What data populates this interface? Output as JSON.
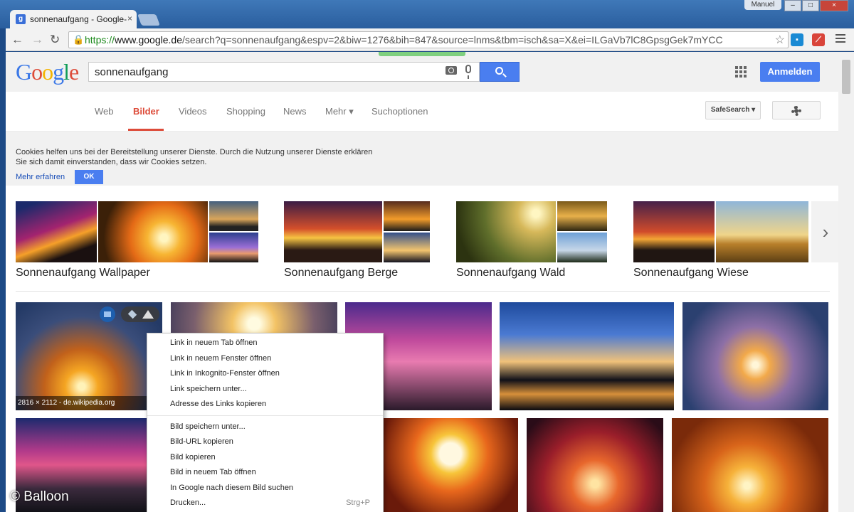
{
  "browser": {
    "tab_title": "sonnenaufgang - Google-",
    "user_label": "Manuel",
    "url_scheme": "https://",
    "url_domain": "www.google.de",
    "url_rest": "/search?q=sonnenaufgang&espv=2&biw=1276&bih=847&source=lnms&tbm=isch&sa=X&ei=ILGaVb7lC8GpsgGek7mYCC"
  },
  "header": {
    "logo_letters": [
      {
        "ch": "G",
        "color": "#3b78e7"
      },
      {
        "ch": "o",
        "color": "#dd4b39"
      },
      {
        "ch": "o",
        "color": "#f4b400"
      },
      {
        "ch": "g",
        "color": "#3b78e7"
      },
      {
        "ch": "l",
        "color": "#0f9d58"
      },
      {
        "ch": "e",
        "color": "#dd4b39"
      }
    ],
    "search_value": "sonnenaufgang",
    "signin_label": "Anmelden"
  },
  "nav": {
    "items": [
      "Web",
      "Bilder",
      "Videos",
      "Shopping",
      "News",
      "Mehr ▾",
      "Suchoptionen"
    ],
    "active": "Bilder",
    "safesearch_label": "SafeSearch ▾"
  },
  "cookie": {
    "text": "Cookies helfen uns bei der Bereitstellung unserer Dienste. Durch die Nutzung unserer Dienste erklären Sie sich damit einverstanden, dass wir Cookies setzen.",
    "learn_more": "Mehr erfahren",
    "ok": "OK"
  },
  "related": {
    "labels": [
      "Sonnenaufgang Wallpaper",
      "Sonnenaufgang Berge",
      "Sonnenaufgang Wald",
      "Sonnenaufgang Wiese"
    ]
  },
  "results": {
    "first_meta": "2816 × 2112 - de.wikipedia.org"
  },
  "context_menu": {
    "group1": [
      "Link in neuem Tab öffnen",
      "Link in neuem Fenster öffnen",
      "Link in Inkognito-Fenster öffnen",
      "Link speichern unter...",
      "Adresse des Links kopieren"
    ],
    "group2": [
      "Bild speichern unter...",
      "Bild-URL kopieren",
      "Bild kopieren",
      "Bild in neuem Tab öffnen",
      "In Google nach diesem Bild suchen",
      "Drucken..."
    ],
    "print_shortcut": "Strg+P"
  },
  "watermark": "© Balloon",
  "colors": {
    "accent": "#4a7ef0",
    "active_tab": "#dd4b39"
  }
}
